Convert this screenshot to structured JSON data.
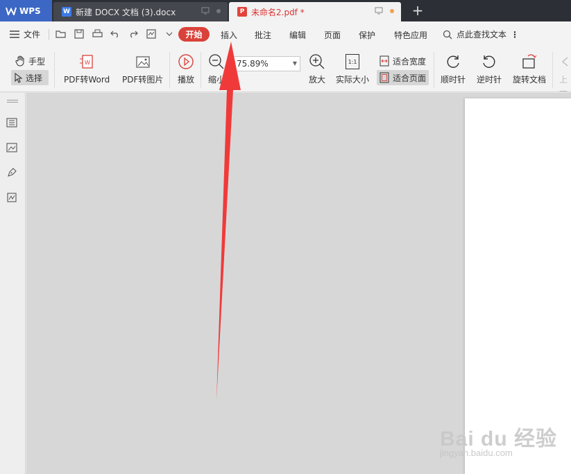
{
  "titlebar": {
    "app_label": "WPS",
    "tabs": [
      {
        "label": "新建 DOCX 文档 (3).docx"
      },
      {
        "label": "未命名2.pdf *"
      }
    ],
    "new_tab": "+"
  },
  "menubar": {
    "file_label": "文件",
    "tabs": [
      "开始",
      "插入",
      "批注",
      "编辑",
      "页面",
      "保护",
      "特色应用"
    ],
    "active_tab": "开始",
    "search_label": "点此查找文本"
  },
  "toolbar": {
    "hand_label": "手型",
    "select_label": "选择",
    "pdf_to_word": "PDF转Word",
    "pdf_to_image": "PDF转图片",
    "play": "播放",
    "zoom_out": "缩小",
    "zoom_value": "75.89%",
    "zoom_in": "放大",
    "actual_size": "实际大小",
    "actual_size_icon": "1:1",
    "fit_width": "适合宽度",
    "fit_page": "适合页面",
    "rotate_cw": "顺时针",
    "rotate_ccw": "逆时针",
    "rotate_doc": "旋转文档",
    "prev": "上一"
  },
  "colors": {
    "accent_red": "#d9423a",
    "wps_blue": "#3c67c4",
    "titlebar_bg": "#2d2f36",
    "arrow_red": "#f03a3a"
  },
  "watermark": {
    "main": "Bai du 经验",
    "sub": "jingyan.baidu.com"
  }
}
